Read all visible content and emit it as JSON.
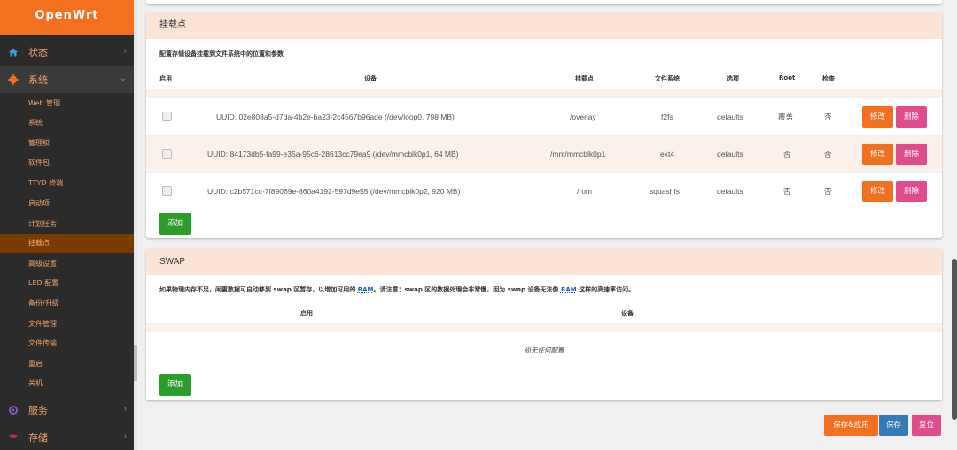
{
  "brand": "OpenWrt",
  "sidebar": {
    "status": "状态",
    "system": "系统",
    "services": "服务",
    "storage": "存储",
    "submenu": [
      "Web 管理",
      "系统",
      "管理权",
      "软件包",
      "TTYD 终端",
      "启动项",
      "计划任务",
      "挂载点",
      "高级设置",
      "LED 配置",
      "备份/升级",
      "文件管理",
      "文件传输",
      "重启",
      "关机"
    ]
  },
  "mount": {
    "title": "挂载点",
    "description": "配置存储设备挂载到文件系统中的位置和参数",
    "headers": {
      "enable": "启用",
      "device": "设备",
      "mountpoint": "挂载点",
      "fs": "文件系统",
      "options": "选项",
      "root": "Root",
      "check": "检查"
    },
    "rows": [
      {
        "device": "UUID: 02e808a5-d7da-4b2e-ba23-2c4567b96ade (/dev/loop0, 798 MB)",
        "mountpoint": "/overlay",
        "fs": "f2fs",
        "options": "defaults",
        "root": "覆盖",
        "check": "否"
      },
      {
        "device": "UUID: 84173db5-fa99-e35a-95c6-28613cc79ea9 (/dev/mmcblk0p1, 64 MB)",
        "mountpoint": "/mnt/mmcblk0p1",
        "fs": "ext4",
        "options": "defaults",
        "root": "否",
        "check": "否"
      },
      {
        "device": "UUID: c2b571cc-7f89069e-860a4192-597d9e55 (/dev/mmcblk0p2, 920 MB)",
        "mountpoint": "/rom",
        "fs": "squashfs",
        "options": "defaults",
        "root": "否",
        "check": "否"
      }
    ],
    "edit_label": "修改",
    "delete_label": "删除",
    "add_label": "添加"
  },
  "swap": {
    "title": "SWAP",
    "description_a": "如果物理内存不足，闲置数据可自动移到 swap 区暂存，以增加可用的 ",
    "ram1": "RAM",
    "description_b": "。请注意：swap 区的数据处理会非常慢，因为 swap 设备无法像 ",
    "ram2": "RAM",
    "description_c": " 这样的高速率访问。",
    "headers": {
      "enable": "启用",
      "device": "设备"
    },
    "empty": "尚无任何配置",
    "add_label": "添加"
  },
  "footer": {
    "save_apply": "保存&应用",
    "save": "保存",
    "reset": "复位"
  },
  "colors": {
    "accent": "#f37021",
    "header_bg": "#fbe4d5",
    "add": "#2a9d2a",
    "delete": "#e04b8c",
    "save": "#337ab7"
  }
}
